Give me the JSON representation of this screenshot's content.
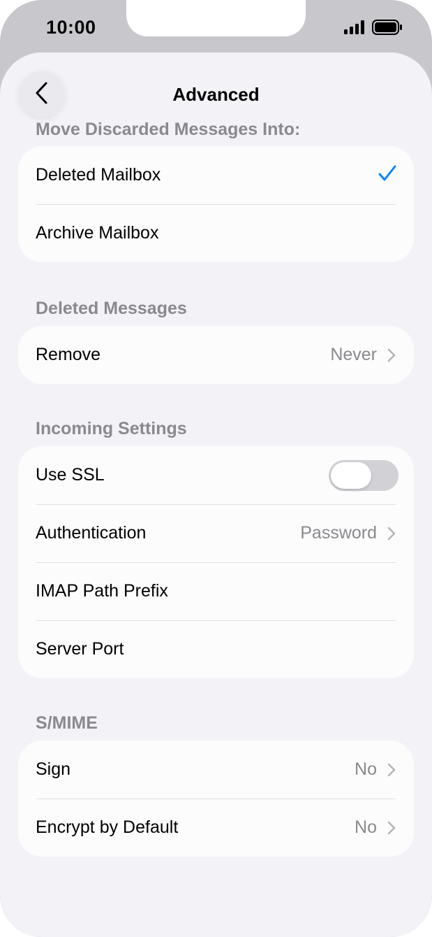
{
  "status_bar": {
    "time": "10:00"
  },
  "nav": {
    "title": "Advanced"
  },
  "sections": {
    "move_discarded": {
      "header": "Move Discarded Messages Into:",
      "rows": [
        {
          "label": "Deleted Mailbox",
          "checked": true
        },
        {
          "label": "Archive Mailbox",
          "checked": false
        }
      ]
    },
    "deleted_messages": {
      "header": "Deleted Messages",
      "rows": [
        {
          "label": "Remove",
          "value": "Never"
        }
      ]
    },
    "incoming_settings": {
      "header": "Incoming Settings",
      "rows": [
        {
          "label": "Use SSL",
          "toggle": false
        },
        {
          "label": "Authentication",
          "value": "Password"
        },
        {
          "label": "IMAP Path Prefix"
        },
        {
          "label": "Server Port"
        }
      ]
    },
    "smime": {
      "header": "S/MIME",
      "rows": [
        {
          "label": "Sign",
          "value": "No"
        },
        {
          "label": "Encrypt by Default",
          "value": "No"
        }
      ]
    }
  },
  "colors": {
    "accent": "#0a84ff",
    "background": "#f2f2f7",
    "secondary_text": "#8a8a8e"
  }
}
